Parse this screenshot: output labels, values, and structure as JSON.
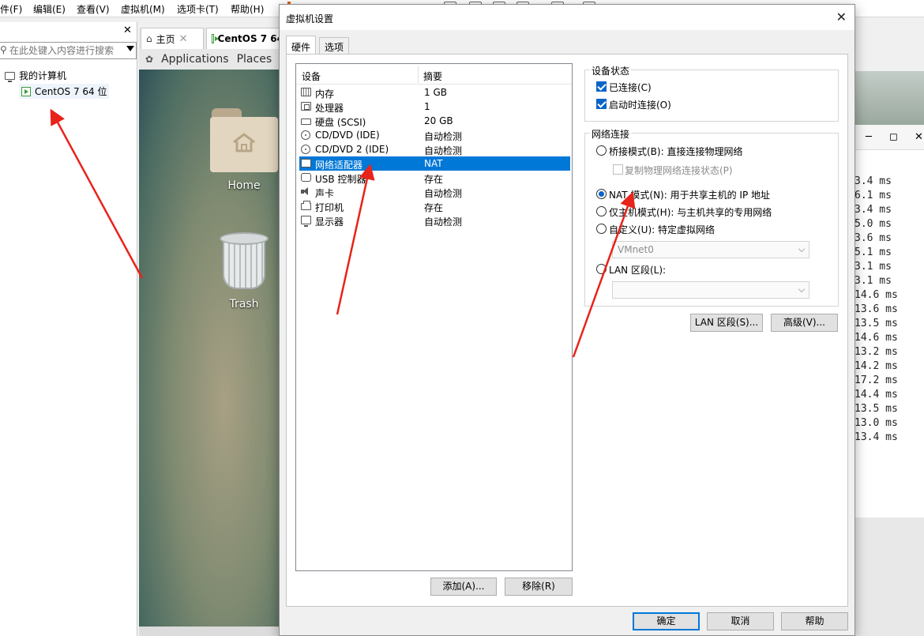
{
  "menubar": {
    "items": [
      "件(F)",
      "编辑(E)",
      "查看(V)",
      "虚拟机(M)",
      "选项卡(T)",
      "帮助(H)"
    ]
  },
  "library": {
    "search_placeholder": "在此处键入内容进行搜索",
    "tree": {
      "root": "我的计算机",
      "vm": "CentOS 7 64 位"
    }
  },
  "vm_tabs": {
    "home": "主页",
    "vm": "CentOS 7 64"
  },
  "gnome_bar": {
    "applications": "Applications",
    "places": "Places"
  },
  "desktop": {
    "home_label": "Home",
    "trash_label": "Trash"
  },
  "terminal": {
    "ping_times": [
      "3.4 ms",
      "6.1 ms",
      "3.4 ms",
      "5.0 ms",
      "3.6 ms",
      "5.1 ms",
      "3.1 ms",
      "3.1 ms",
      "14.6 ms",
      "13.6 ms",
      "13.5 ms",
      "14.6 ms",
      "13.2 ms",
      "14.2 ms",
      "17.2 ms",
      "14.4 ms",
      "13.5 ms",
      "13.0 ms",
      "13.4 ms"
    ]
  },
  "dialog": {
    "title": "虚拟机设置",
    "tabs": {
      "hardware": "硬件",
      "options": "选项"
    },
    "device_list": {
      "col_device": "设备",
      "col_summary": "摘要",
      "rows": [
        {
          "name": "内存",
          "summary": "1 GB",
          "icon": "memory-icon"
        },
        {
          "name": "处理器",
          "summary": "1",
          "icon": "processor-icon"
        },
        {
          "name": "硬盘 (SCSI)",
          "summary": "20 GB",
          "icon": "hard-disk-icon"
        },
        {
          "name": "CD/DVD (IDE)",
          "summary": "自动检测",
          "icon": "cd-dvd-icon"
        },
        {
          "name": "CD/DVD 2 (IDE)",
          "summary": "自动检测",
          "icon": "cd-dvd-icon"
        },
        {
          "name": "网络适配器",
          "summary": "NAT",
          "icon": "network-adapter-icon"
        },
        {
          "name": "USB 控制器",
          "summary": "存在",
          "icon": "usb-controller-icon"
        },
        {
          "name": "声卡",
          "summary": "自动检测",
          "icon": "sound-card-icon"
        },
        {
          "name": "打印机",
          "summary": "存在",
          "icon": "printer-icon"
        },
        {
          "name": "显示器",
          "summary": "自动检测",
          "icon": "display-icon"
        }
      ]
    },
    "add_button": "添加(A)...",
    "remove_button": "移除(R)",
    "device_status": {
      "title": "设备状态",
      "connected": "已连接(C)",
      "connect_at_power_on": "启动时连接(O)"
    },
    "network_connection": {
      "title": "网络连接",
      "bridged": "桥接模式(B): 直接连接物理网络",
      "replicate_state": "复制物理网络连接状态(P)",
      "nat": "NAT 模式(N): 用于共享主机的 IP 地址",
      "host_only": "仅主机模式(H): 与主机共享的专用网络",
      "custom": "自定义(U): 特定虚拟网络",
      "custom_value": "VMnet0",
      "lan_segment": "LAN 区段(L):",
      "lan_segment_value": ""
    },
    "lan_segments_button": "LAN 区段(S)...",
    "advanced_button": "高级(V)...",
    "ok_button": "确定",
    "cancel_button": "取消",
    "help_button": "帮助"
  },
  "colors": {
    "selection": "#0078d7",
    "checkbox_accent": "#0a64c8",
    "annotation_arrow": "#e8231a"
  }
}
